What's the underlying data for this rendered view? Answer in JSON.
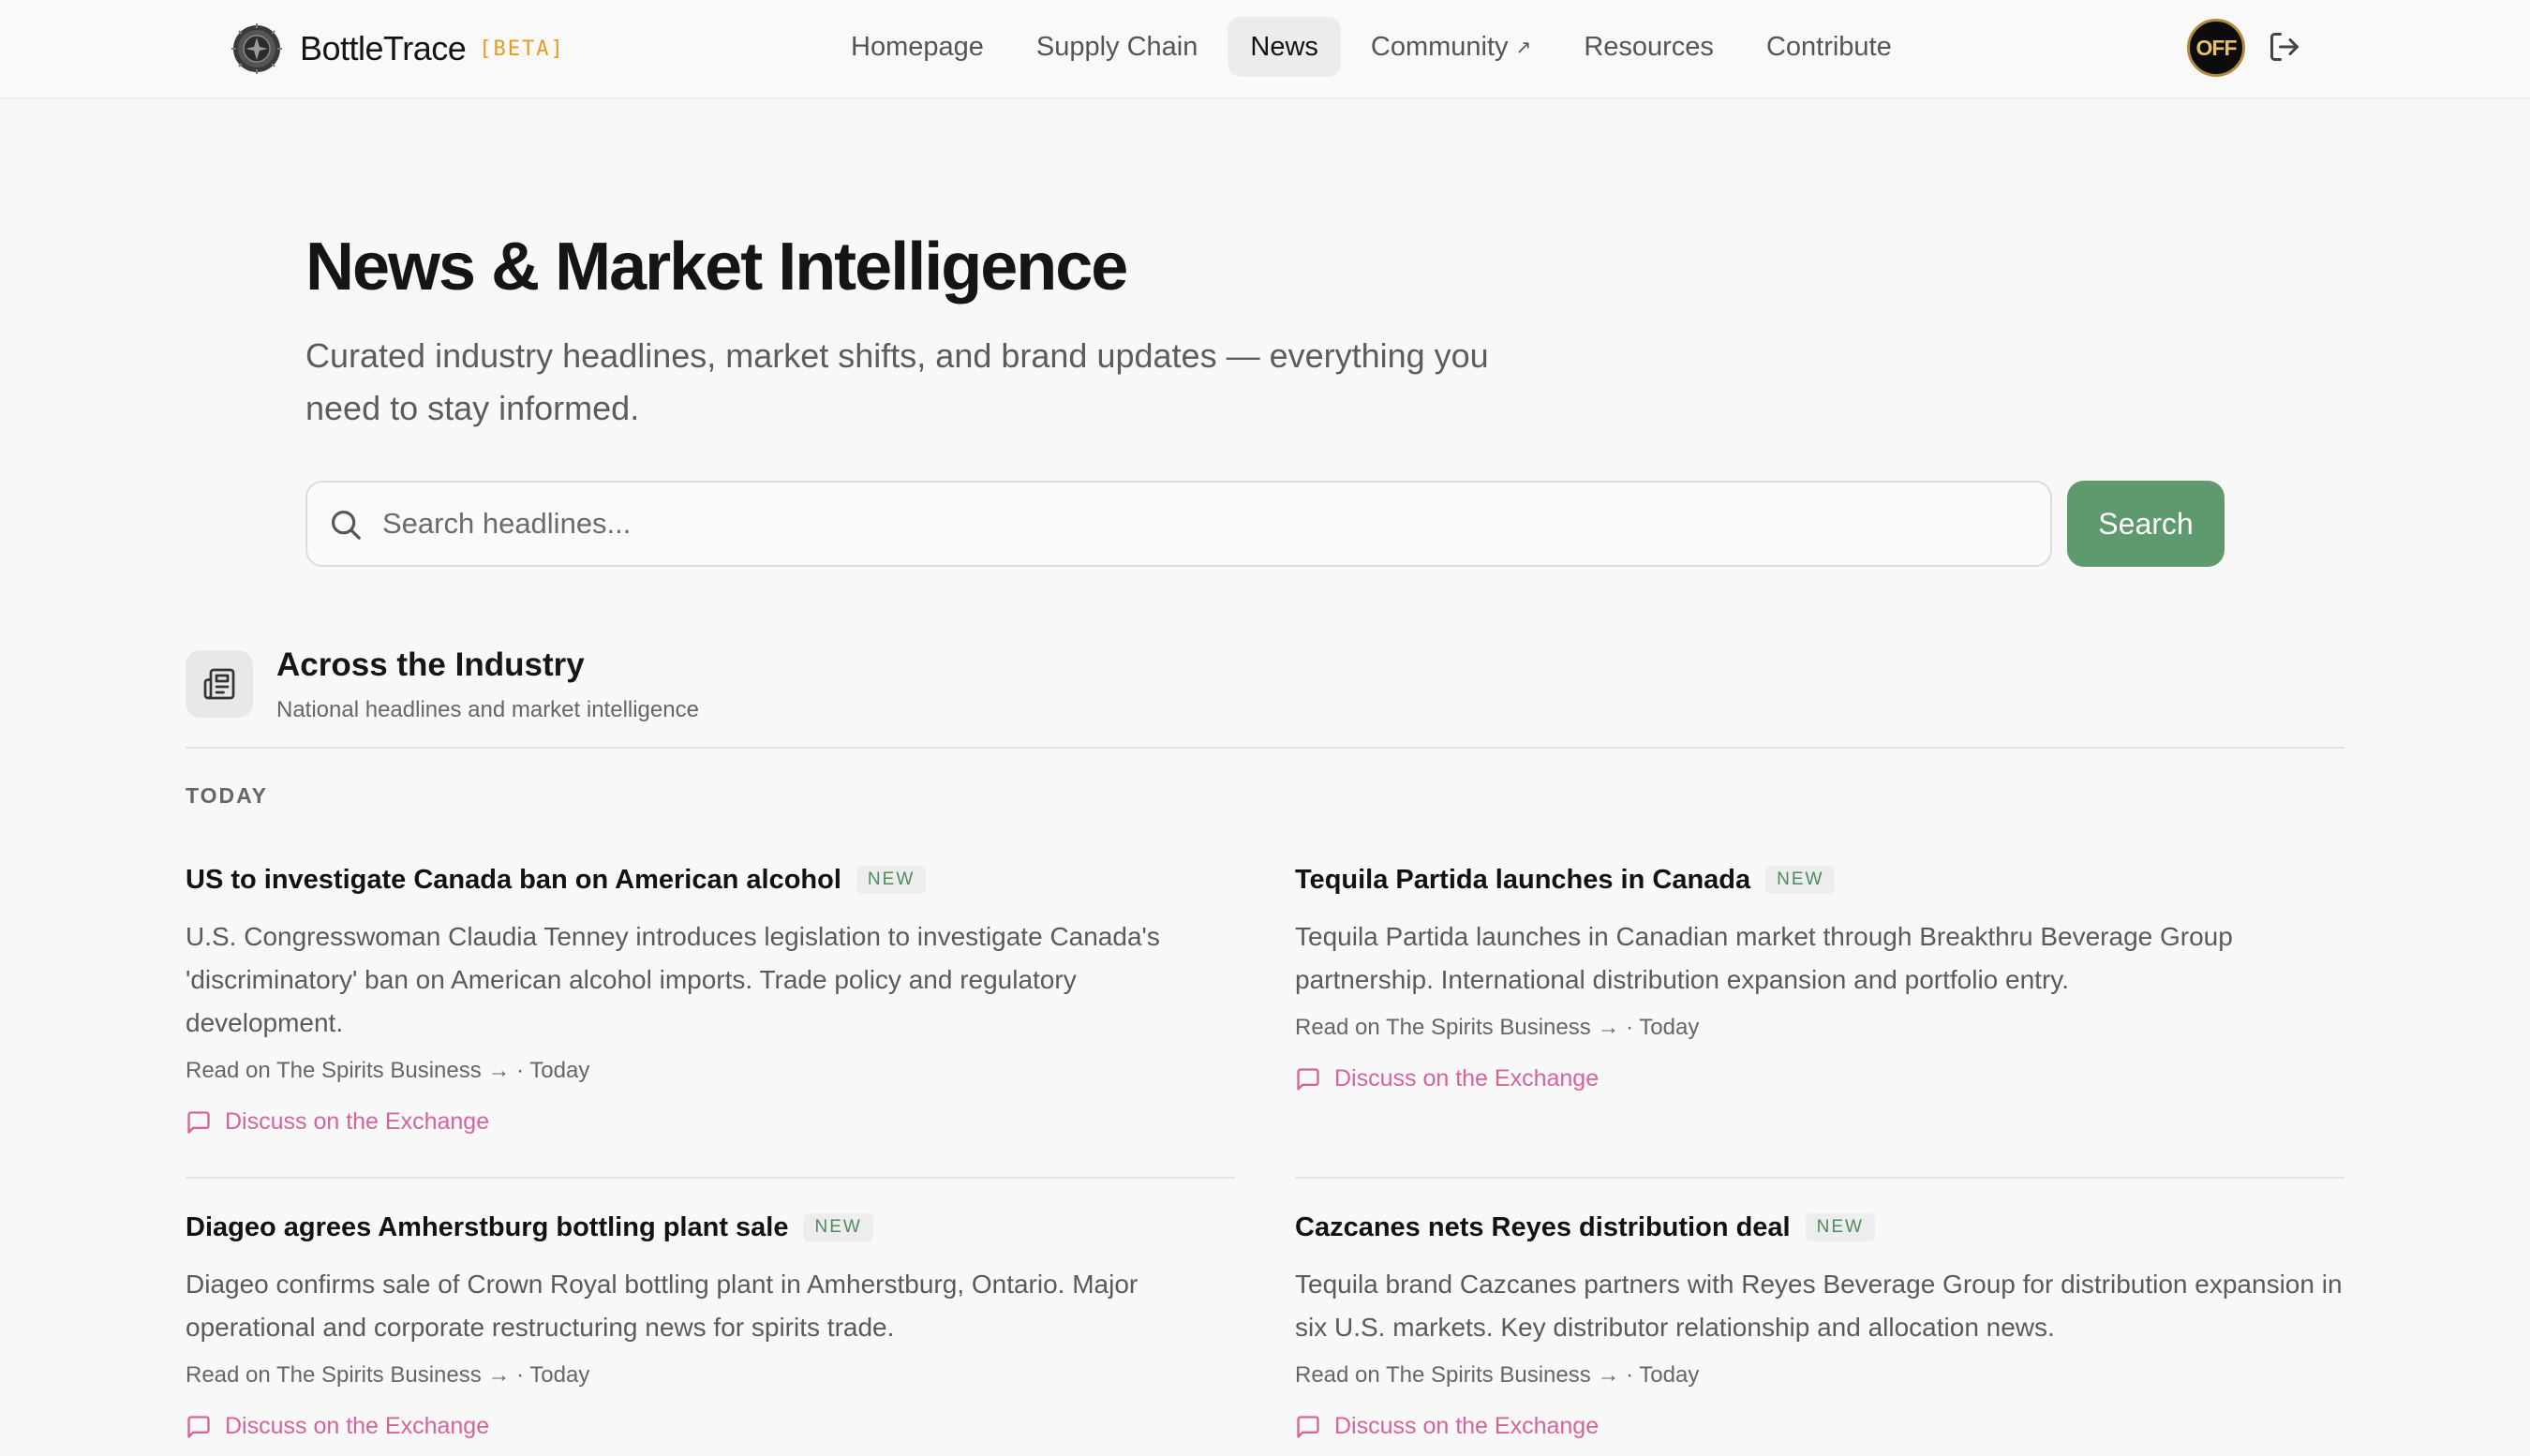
{
  "brand": {
    "name": "BottleTrace",
    "badge": "[BETA]"
  },
  "nav": {
    "items": [
      {
        "label": "Homepage",
        "active": false,
        "external": false
      },
      {
        "label": "Supply Chain",
        "active": false,
        "external": false
      },
      {
        "label": "News",
        "active": true,
        "external": false
      },
      {
        "label": "Community",
        "active": false,
        "external": true
      },
      {
        "label": "Resources",
        "active": false,
        "external": false
      },
      {
        "label": "Contribute",
        "active": false,
        "external": false
      }
    ],
    "external_icon": "↗"
  },
  "user": {
    "avatar_text": "OFF"
  },
  "hero": {
    "title": "News & Market Intelligence",
    "subtitle": "Curated industry headlines, market shifts, and brand updates — everything you need to stay informed."
  },
  "search": {
    "placeholder": "Search headlines...",
    "value": "",
    "button_label": "Search"
  },
  "section": {
    "title": "Across the Industry",
    "subtitle": "National headlines and market intelligence",
    "day_label": "TODAY"
  },
  "articles": [
    {
      "title": "US to investigate Canada ban on American alcohol",
      "badge": "NEW",
      "description": "U.S. Congresswoman Claudia Tenney introduces legislation to investigate Canada's 'discriminatory' ban on American alcohol imports. Trade policy and regulatory development.",
      "meta": "Read on The Spirits Business → · Today",
      "discuss": "Discuss on the Exchange"
    },
    {
      "title": "Tequila Partida launches in Canada",
      "badge": "NEW",
      "description": "Tequila Partida launches in Canadian market through Breakthru Beverage Group partnership. International distribution expansion and portfolio entry.",
      "meta": "Read on The Spirits Business → · Today",
      "discuss": "Discuss on the Exchange"
    },
    {
      "title": "Diageo agrees Amherstburg bottling plant sale",
      "badge": "NEW",
      "description": "Diageo confirms sale of Crown Royal bottling plant in Amherstburg, Ontario. Major operational and corporate restructuring news for spirits trade.",
      "meta": "Read on The Spirits Business → · Today",
      "discuss": "Discuss on the Exchange"
    },
    {
      "title": "Cazcanes nets Reyes distribution deal",
      "badge": "NEW",
      "description": "Tequila brand Cazcanes partners with Reyes Beverage Group for distribution expansion in six U.S. markets. Key distributor relationship and allocation news.",
      "meta": "Read on The Spirits Business → · Today",
      "discuss": "Discuss on the Exchange"
    }
  ],
  "colors": {
    "accent_green": "#5f9a6e",
    "beta_orange": "#e89a1e",
    "discuss_pink": "#d6649a",
    "badge_green": "#4e8a5d"
  },
  "icons": {
    "logo": "bottle-seal-logo",
    "logout": "logout-icon",
    "search": "search-icon",
    "section": "newspaper-icon",
    "discuss": "chat-bubble-icon"
  }
}
